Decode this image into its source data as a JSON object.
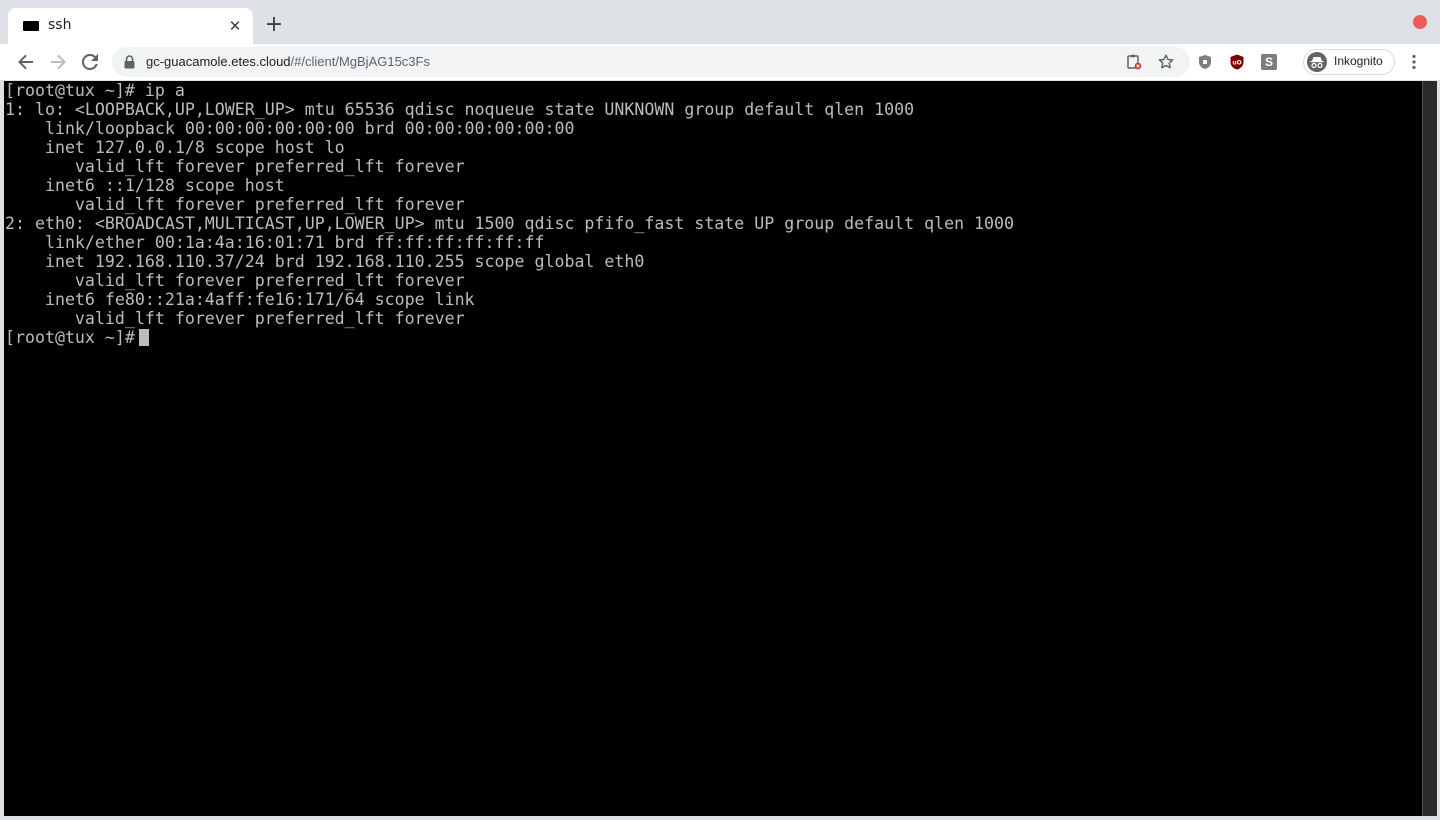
{
  "tab": {
    "title": "ssh",
    "favicon": "terminal-favicon-icon",
    "close_glyph": "✕"
  },
  "new_tab_glyph": "+",
  "toolbar": {
    "back_icon": "back-arrow-icon",
    "forward_icon": "forward-arrow-icon",
    "reload_icon": "reload-icon"
  },
  "omnibox": {
    "host": "gc-guacamole.etes.cloud",
    "path": "/#/client/MgBjAG15c3Fs"
  },
  "extensions": {
    "ext1_letter": "S"
  },
  "profile": {
    "label": "Inkognito"
  },
  "terminal": {
    "lines": [
      "[root@tux ~]# ip a",
      "1: lo: <LOOPBACK,UP,LOWER_UP> mtu 65536 qdisc noqueue state UNKNOWN group default qlen 1000",
      "    link/loopback 00:00:00:00:00:00 brd 00:00:00:00:00:00",
      "    inet 127.0.0.1/8 scope host lo",
      "       valid_lft forever preferred_lft forever",
      "    inet6 ::1/128 scope host",
      "       valid_lft forever preferred_lft forever",
      "2: eth0: <BROADCAST,MULTICAST,UP,LOWER_UP> mtu 1500 qdisc pfifo_fast state UP group default qlen 1000",
      "    link/ether 00:1a:4a:16:01:71 brd ff:ff:ff:ff:ff:ff",
      "    inet 192.168.110.37/24 brd 192.168.110.255 scope global eth0",
      "       valid_lft forever preferred_lft forever",
      "    inet6 fe80::21a:4aff:fe16:171/64 scope link",
      "       valid_lft forever preferred_lft forever"
    ],
    "prompt": "[root@tux ~]#"
  },
  "colors": {
    "terminal_bg": "#000000",
    "terminal_fg": "#bcbcbc",
    "window_close": "#ee5b5b",
    "ublock_red": "#800000"
  }
}
